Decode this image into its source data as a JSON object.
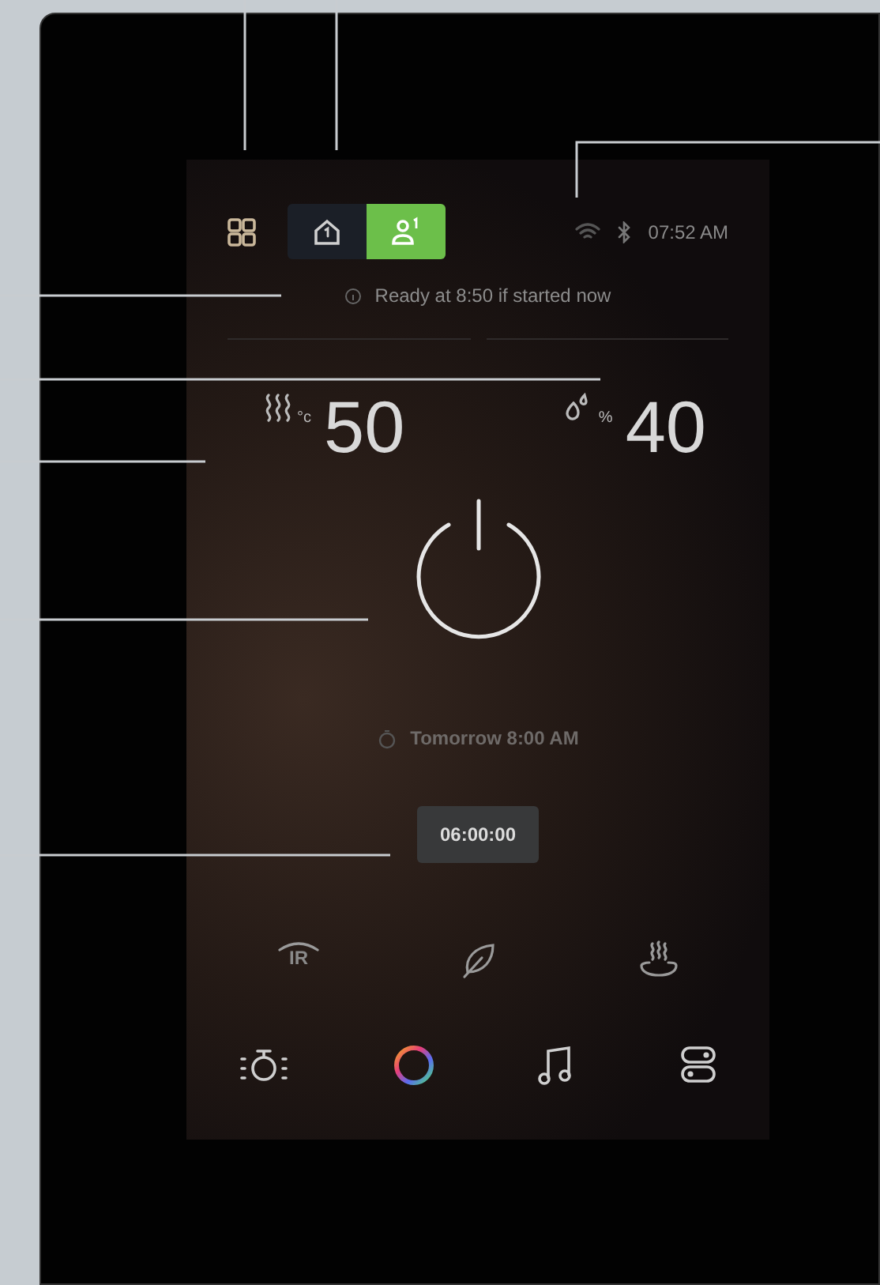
{
  "header": {
    "modes": [
      {
        "kind": "home",
        "selected": false
      },
      {
        "kind": "user",
        "selected": true
      }
    ],
    "status": {
      "time": "07:52 AM"
    }
  },
  "info": "Ready at 8:50 if started now",
  "readings": [
    {
      "kind": "temperature",
      "unit": "°c",
      "value": "50"
    },
    {
      "kind": "humidity",
      "unit": "%",
      "value": "40"
    }
  ],
  "power": {
    "on": false
  },
  "schedule": "Tomorrow 8:00 AM",
  "timer": "06:00:00",
  "features": [
    {
      "kind": "ir",
      "label": "IR"
    },
    {
      "kind": "eco"
    },
    {
      "kind": "steam"
    }
  ],
  "controls": [
    {
      "kind": "light"
    },
    {
      "kind": "color"
    },
    {
      "kind": "music"
    },
    {
      "kind": "toggles"
    }
  ]
}
